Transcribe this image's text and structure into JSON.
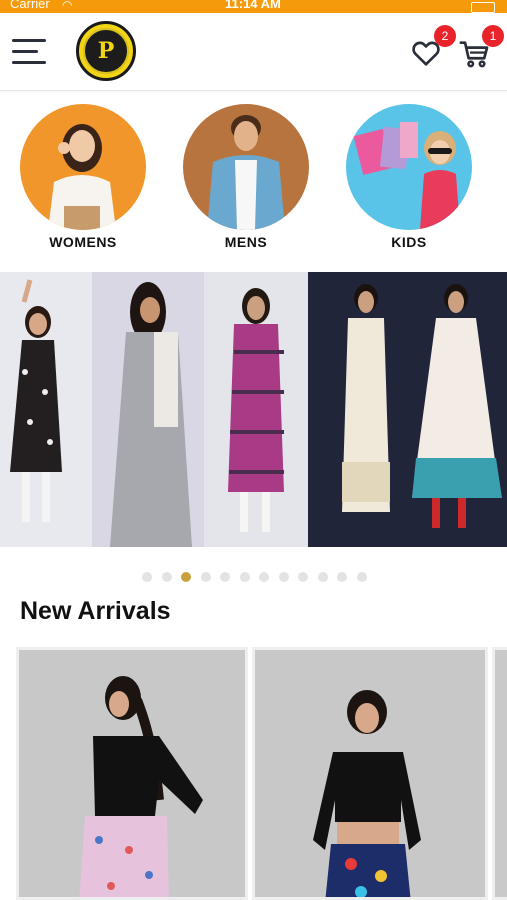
{
  "status_bar": {
    "carrier": "Carrier",
    "time": "11:14 AM"
  },
  "header": {
    "menu_icon": "hamburger-menu-icon",
    "logo_letter": "P",
    "wishlist": {
      "icon": "heart-icon",
      "count": "2"
    },
    "cart": {
      "icon": "cart-icon",
      "count": "1"
    }
  },
  "categories": [
    {
      "label": "WOMENS",
      "bg": "#f0962a"
    },
    {
      "label": "MENS",
      "bg": "#b8743f"
    },
    {
      "label": "KIDS",
      "bg": "#59c3e8"
    }
  ],
  "carousel": {
    "slide_count": 12,
    "active_index": 2
  },
  "colors": {
    "accent": "#f59a0a",
    "badge": "#e8232a",
    "active_dot": "#c9a13b"
  },
  "new_arrivals": {
    "title": "New Arrivals"
  }
}
